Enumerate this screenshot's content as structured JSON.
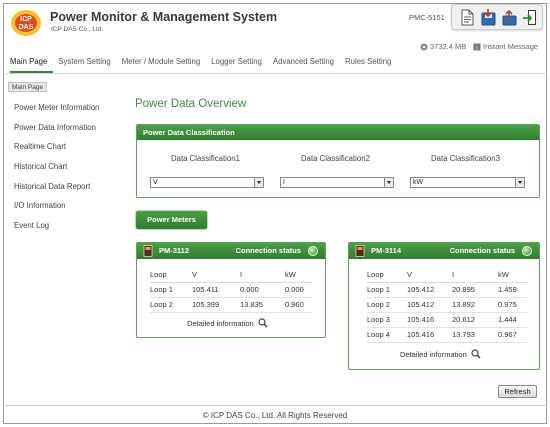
{
  "header": {
    "logo_text": "ICP DAS",
    "title": "Power Monitor & Management System",
    "company": "ICP DAS Co., Ltd.",
    "model": "PMC-5151",
    "memory": "3732.4 MB",
    "instant_message": "Instant Message",
    "toolbar_icons": [
      "document-icon",
      "save-icon",
      "upload-icon",
      "logout-icon"
    ]
  },
  "nav": [
    "Main Page",
    "System Setting",
    "Meter / Module Setting",
    "Logger Setting",
    "Advanced Setting",
    "Rules Setting"
  ],
  "breadcrumb": "Main Page",
  "sidebar": [
    "Power Meter Information",
    "Power Data Information",
    "Realtime Chart",
    "Historical Chart",
    "Historical Data Report",
    "I/O Information",
    "Event Log"
  ],
  "page_title": "Power Data Overview",
  "classification": {
    "title": "Power Data Classification",
    "labels": [
      "Data Classification1",
      "Data Classification2",
      "Data Classification3"
    ],
    "values": [
      "V",
      "I",
      "kW"
    ]
  },
  "power_meters_button": "Power Meters",
  "meters": [
    {
      "name": "PM-3112",
      "status_label": "Connection status",
      "headers": [
        "Loop",
        "V",
        "I",
        "kW"
      ],
      "rows": [
        [
          "Loop 1",
          "105.411",
          "0.000",
          "0.000"
        ],
        [
          "Loop 2",
          "105.399",
          "13.835",
          "0.960"
        ]
      ],
      "detail": "Detailed information"
    },
    {
      "name": "PM-3114",
      "status_label": "Connection status",
      "headers": [
        "Loop",
        "V",
        "I",
        "kW"
      ],
      "rows": [
        [
          "Loop 1",
          "105.412",
          "20.895",
          "1.459"
        ],
        [
          "Loop 2",
          "105.412",
          "13.892",
          "0.975"
        ],
        [
          "Loop 3",
          "105.416",
          "20.612",
          "1.444"
        ],
        [
          "Loop 4",
          "105.416",
          "13.793",
          "0.967"
        ]
      ],
      "detail": "Detailed information"
    }
  ],
  "refresh_label": "Refresh",
  "footer": "© ICP DAS Co., Ltd. All Rights Reserved",
  "colors": {
    "accent": "#2f7d2e",
    "title_green": "#3c8a48",
    "status_led": "#5cc04a"
  }
}
